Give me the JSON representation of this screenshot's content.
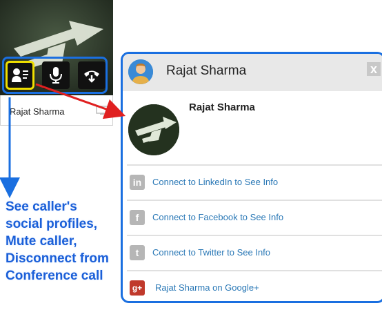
{
  "caller_tile": {
    "name": "Rajat Sharma"
  },
  "controls": {
    "profile_icon": "contact-card-icon",
    "mute_icon": "microphone-icon",
    "hangup_icon": "hangup-phone-icon"
  },
  "annotation": {
    "lines": [
      "See caller's",
      "social profiles,",
      "Mute caller,",
      "Disconnect from",
      "Conference call"
    ]
  },
  "popup": {
    "header_name": "Rajat Sharma",
    "close_label": "x",
    "card_name": "Rajat Sharma",
    "rows": [
      {
        "icon_text": "in",
        "icon": "linkedin-icon",
        "label": "Connect to LinkedIn to See Info"
      },
      {
        "icon_text": "f",
        "icon": "facebook-icon",
        "label": "Connect to Facebook to See Info"
      },
      {
        "icon_text": "t",
        "icon": "twitter-icon",
        "label": "Connect to Twitter to See Info"
      },
      {
        "icon_text": "g+",
        "icon": "google-plus-icon",
        "label": "Rajat Sharma on Google+"
      }
    ]
  },
  "colors": {
    "highlight_blue": "#1a6fe0",
    "highlight_yellow": "#f0e000",
    "arrow_red": "#e02020",
    "link_blue": "#2a78b6"
  }
}
